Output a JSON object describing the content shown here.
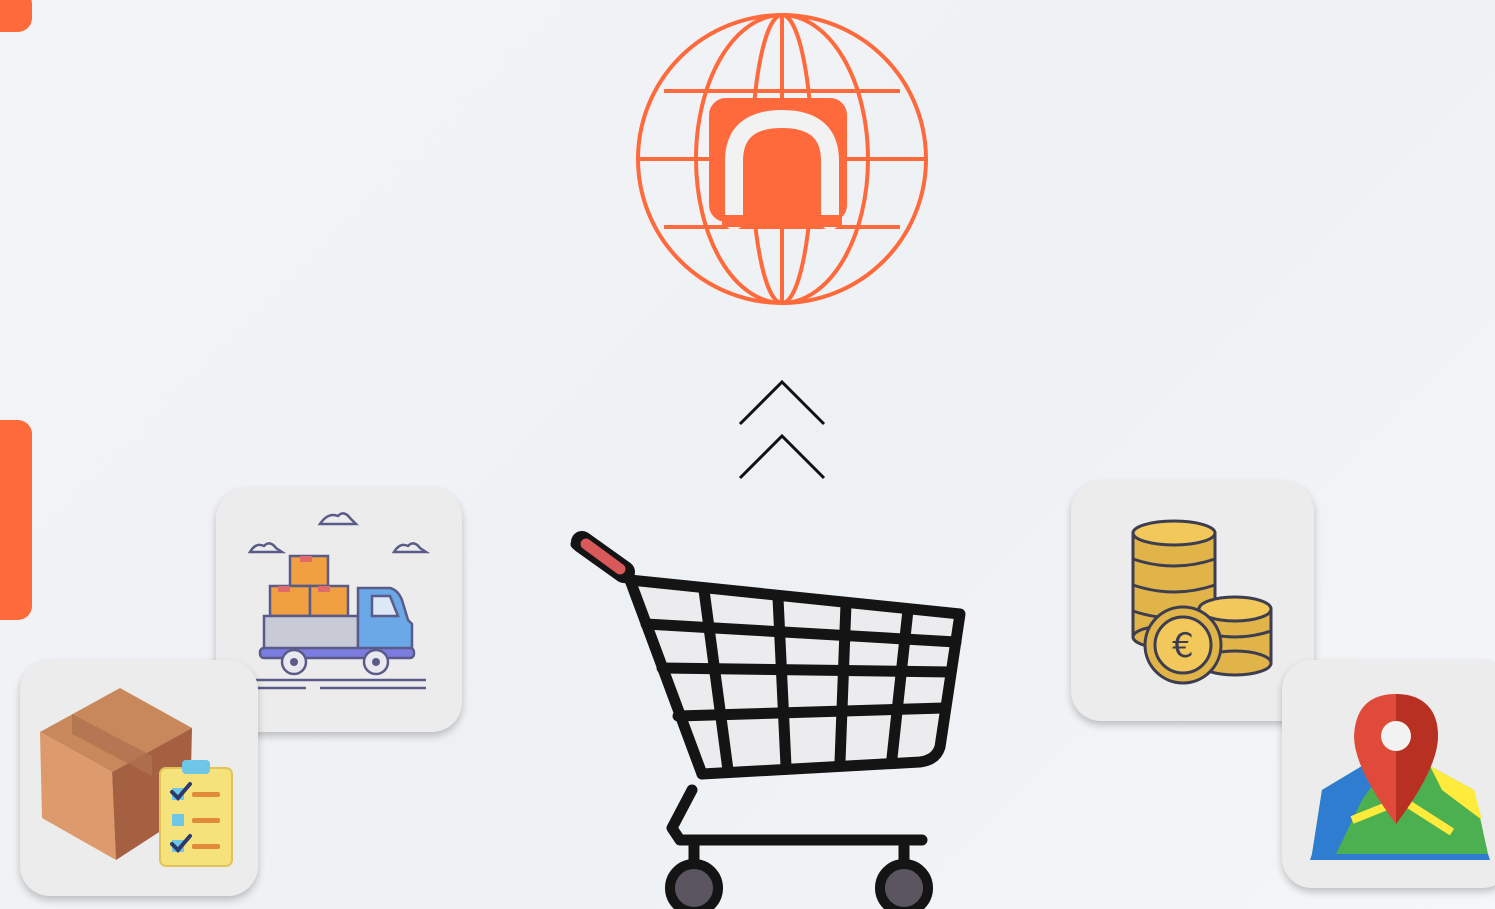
{
  "colors": {
    "brand": "#ff6a3d",
    "background": "#f1f3f5",
    "card": "#ececed",
    "cart_stroke": "#141414",
    "cart_handle": "#d9585a"
  },
  "icons": {
    "hero": "globe-brand-logo-icon",
    "arrow": "double-chevron-up-icon",
    "center": "shopping-cart-icon",
    "cards": [
      "delivery-truck-icon",
      "package-checklist-icon",
      "euro-coins-icon",
      "map-pin-icon"
    ]
  }
}
